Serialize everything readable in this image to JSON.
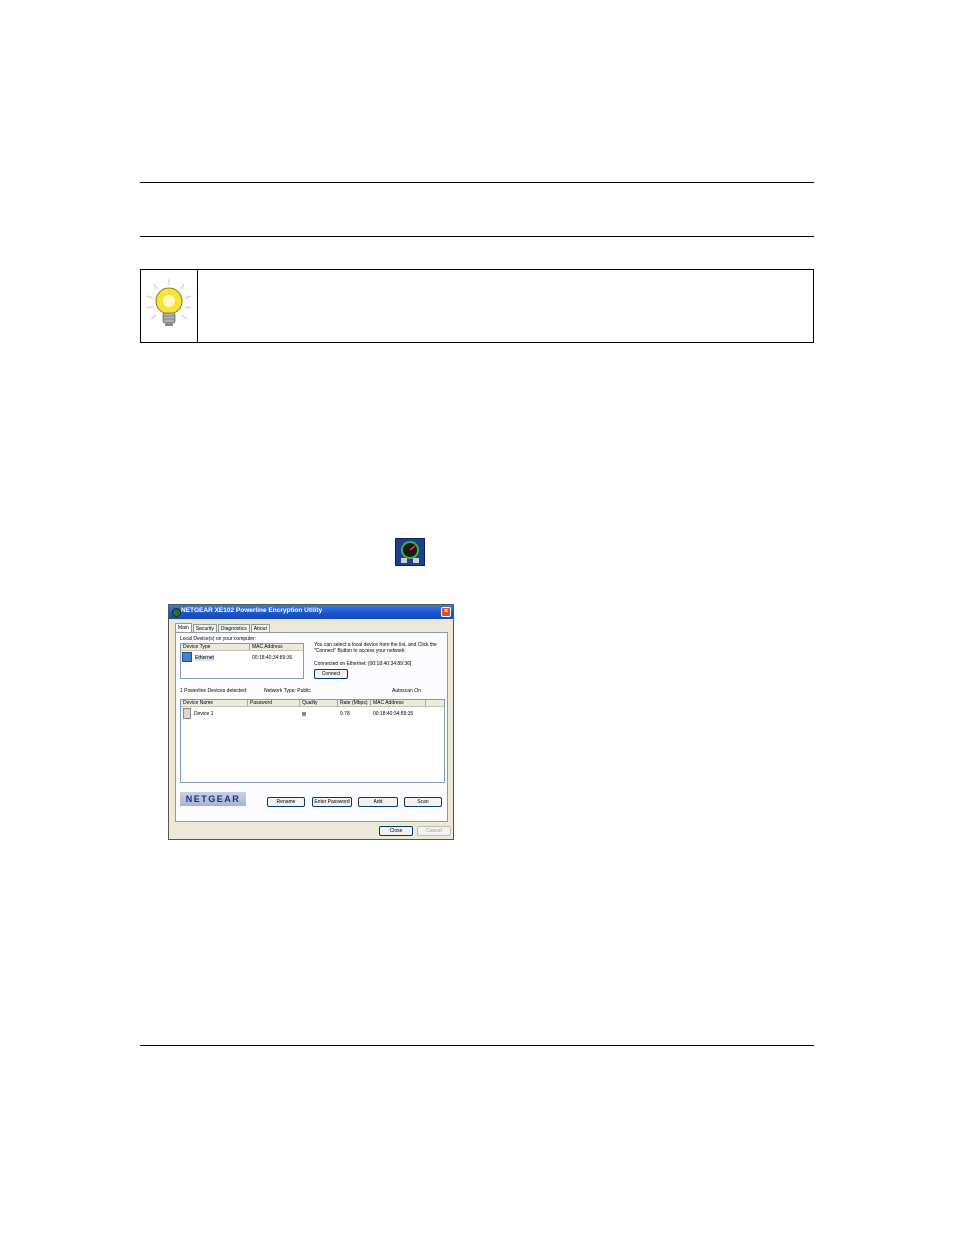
{
  "dialog": {
    "title": "NETGEAR XE102 Powerline Encryption Utility",
    "close_glyph": "×",
    "tabs": [
      "Main",
      "Security",
      "Diagnostics",
      "About"
    ],
    "local_devices_label": "Local Device(s) on your computer:",
    "local_table": {
      "headers": [
        "Device Type",
        "MAC Address"
      ],
      "rows": [
        {
          "type": "Ethernet",
          "mac": "00:18:40:34:89:36"
        }
      ]
    },
    "instruction": "You can select a local device from the list, and Click the \"Connect\" Button to access your network",
    "connected_status": "Connected on Ethernet: [00:18:40:34:89:36]",
    "connect_button": "Connect",
    "detected_label": "1 Powerline Devices detected:",
    "network_type": "Network Type: Public",
    "autoscan": "Autoscan On",
    "powerline_table": {
      "headers": [
        "Device Name",
        "Password",
        "Quality",
        "Rate (Mbps)",
        "MAC Address"
      ],
      "rows": [
        {
          "name": "Device 1",
          "password": "",
          "rate": "9.78",
          "mac": "00:18:40:34:89:35"
        }
      ]
    },
    "logo_text": "NETGEAR",
    "buttons": {
      "rename": "Rename",
      "enter_password": "Enter Password",
      "add": "Add",
      "scan": "Scan",
      "close": "Close",
      "cancel": "Cancel"
    }
  },
  "colors": {
    "titlebar": "#1a55c8",
    "dialog_bg": "#ece9d8",
    "quality_indicator": "#8c8c8c",
    "tip_bulb": "#f5e43a"
  },
  "icons": {
    "tip": "lightbulb-icon",
    "tray": "powerline-utility-tray-icon"
  }
}
